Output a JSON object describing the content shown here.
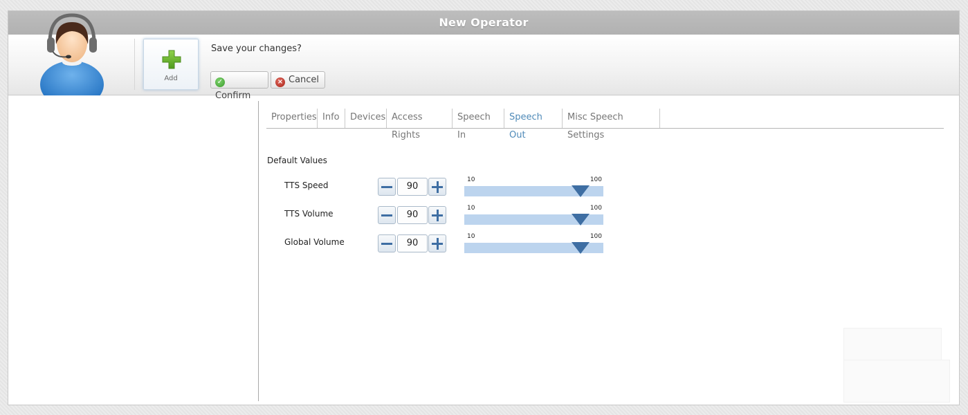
{
  "window": {
    "title": "New Operator"
  },
  "toolbar": {
    "add_label": "Add",
    "prompt": "Save your changes?",
    "confirm_label": "Confirm",
    "cancel_label": "Cancel",
    "icons": {
      "avatar": "operator-headset-icon",
      "add": "plus-icon",
      "confirm": "checkmark-icon",
      "cancel": "x-icon"
    }
  },
  "tabs": [
    {
      "label": "Properties",
      "active": false
    },
    {
      "label": "Info",
      "active": false
    },
    {
      "label": "Devices",
      "active": false
    },
    {
      "label": "Access Rights",
      "active": false
    },
    {
      "label": "Speech In",
      "active": false
    },
    {
      "label": "Speech Out",
      "active": true
    },
    {
      "label": "Misc Speech Settings",
      "active": false
    }
  ],
  "content": {
    "section_title": "Default Values",
    "settings": [
      {
        "label": "TTS Speed",
        "value": "90",
        "min": "10",
        "max": "100"
      },
      {
        "label": "TTS Volume",
        "value": "90",
        "min": "10",
        "max": "100"
      },
      {
        "label": "Global Volume",
        "value": "90",
        "min": "10",
        "max": "100"
      }
    ]
  },
  "colors": {
    "accent": "#4f8ab8",
    "slider_track": "#bcd4ee",
    "stepper_icon": "#3e6ea3",
    "confirm": "#3a9b2c",
    "cancel": "#a82217"
  }
}
